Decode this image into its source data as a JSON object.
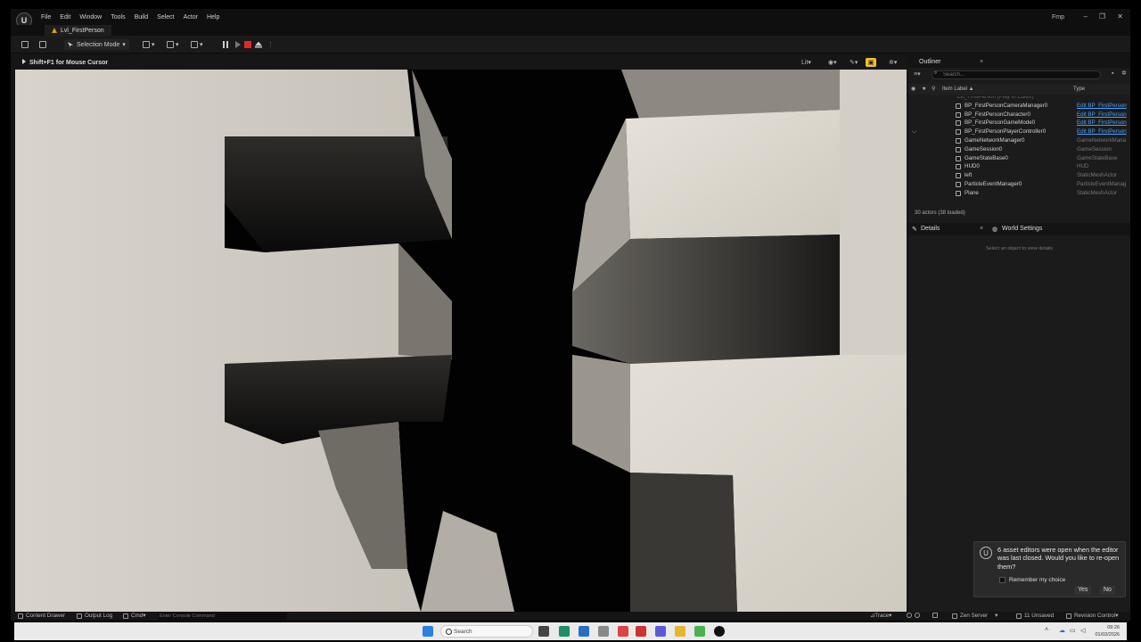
{
  "window": {
    "logo": "U",
    "menu": [
      "File",
      "Edit",
      "Window",
      "Tools",
      "Build",
      "Select",
      "Actor",
      "Help"
    ],
    "user": "Fmp",
    "controls": [
      "–",
      "❐",
      "✕"
    ]
  },
  "level_tab": {
    "label": "Lvl_FirstPerson"
  },
  "toolbar": {
    "selection_mode": "Selection Mode"
  },
  "viewport": {
    "hint": "Shift+F1 for Mouse Cursor",
    "lit_label": "Lit"
  },
  "outliner": {
    "tab_label": "Outliner",
    "close": "×",
    "search_placeholder": "Search...",
    "col_label": "Item Label ▲",
    "col_type": "Type",
    "rows": [
      {
        "name": "Lvl_FirstPerson (Play In Editor)",
        "type": "",
        "dim": true
      },
      {
        "name": "BP_FirstPersonCameraManager0",
        "type": "Edit BP_FirstPerson",
        "link": true
      },
      {
        "name": "BP_FirstPersonCharacter0",
        "type": "Edit BP_FirstPerson",
        "link": true
      },
      {
        "name": "BP_FirstPersonGameMode0",
        "type": "Edit BP_FirstPerson",
        "link": true
      },
      {
        "name": "BP_FirstPersonPlayerController0",
        "type": "Edit BP_FirstPerson",
        "link": true
      },
      {
        "name": "GameNetworkManager0",
        "type": "GameNetworkMana",
        "link": false
      },
      {
        "name": "GameSession0",
        "type": "GameSession",
        "link": false
      },
      {
        "name": "GameStateBase0",
        "type": "GameStateBase",
        "link": false
      },
      {
        "name": "HUD0",
        "type": "HUD",
        "link": false
      },
      {
        "name": "left",
        "type": "StaticMeshActor",
        "link": false
      },
      {
        "name": "ParticleEventManager0",
        "type": "ParticleEventManag",
        "link": false
      },
      {
        "name": "Plane",
        "type": "StaticMeshActor",
        "link": false
      }
    ],
    "actor_count": "30 actors (38 loaded)"
  },
  "details": {
    "tab_label": "Details",
    "close": "×",
    "world_settings": "World Settings",
    "empty_text": "Select an object to view details"
  },
  "toast": {
    "message": "6 asset editors were open when the editor was last closed. Would you like to re-open them?",
    "remember": "Remember my choice",
    "yes": "Yes",
    "no": "No"
  },
  "statusbar": {
    "content_drawer": "Content Drawer",
    "output_log": "Output Log",
    "cmd": "Cmd",
    "console_placeholder": "Enter Console Command",
    "trace": "Trace",
    "zen": "Zen Server",
    "unsaved": "11 Unsaved",
    "revision": "Revision Control"
  },
  "taskbar": {
    "search": "Search",
    "time": "09:26",
    "date": "01/03/2026"
  },
  "colors": {
    "accent": "#f0c030",
    "stop": "#e02828",
    "link": "#4aa3ff"
  }
}
